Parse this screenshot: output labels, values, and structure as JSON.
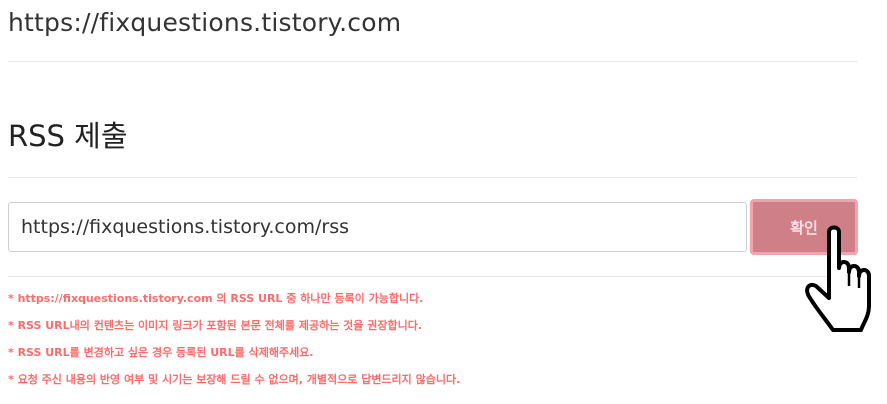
{
  "blog": {
    "url": "https://fixquestions.tistory.com"
  },
  "rss_section": {
    "title": "RSS 제출",
    "input_value": "https://fixquestions.tistory.com/rss",
    "confirm_label": "확인"
  },
  "notices": [
    "* https://fixquestions.tistory.com 의 RSS URL 중 하나만 등록이 가능합니다.",
    "* RSS URL내의 컨텐츠는 이미지 링크가 포함된 본문 전체를 제공하는 것을 권장합니다.",
    "* RSS URL를 변경하고 싶은 경우 등록된 URL를 삭제해주세요.",
    "* 요청 주신 내용의 반영 여부 및 시기는 보장해 드릴 수 없으며, 개별적으로 답변드리지 않습니다."
  ],
  "icons": {
    "cursor": "hand-pointer-icon"
  },
  "colors": {
    "notice_text": "#ff6b6b",
    "button_fill": "#cf7f88",
    "button_border": "#f4a2ab"
  }
}
